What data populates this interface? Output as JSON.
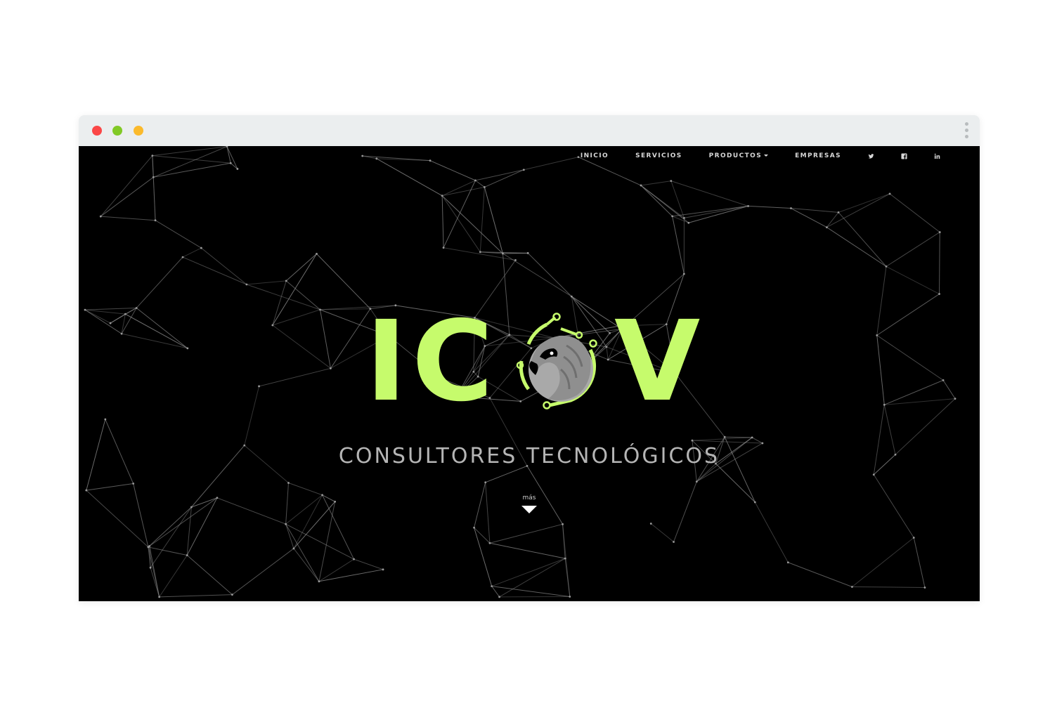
{
  "browser": {
    "traffic_lights": {
      "close_color": "#fb4747",
      "minimize_color": "#81c926",
      "zoom_color": "#fbba2c"
    },
    "menu_icon": "kebab-menu-icon"
  },
  "nav": {
    "items": [
      {
        "label": "INICIO"
      },
      {
        "label": "SERVICIOS"
      },
      {
        "label": "PRODUCTOS"
      },
      {
        "label": "EMPRESAS"
      }
    ],
    "social_icons": [
      "twitter-icon",
      "facebook-icon",
      "linkedin-icon"
    ]
  },
  "hero": {
    "logo_text": {
      "letter_1": "I",
      "letter_2": "C",
      "letter_4": "V"
    },
    "tagline": "CONSULTORES TECNOLÓGICOS",
    "more_label": "más",
    "brand_color": "#c6fb6c",
    "background_color": "#000000"
  }
}
